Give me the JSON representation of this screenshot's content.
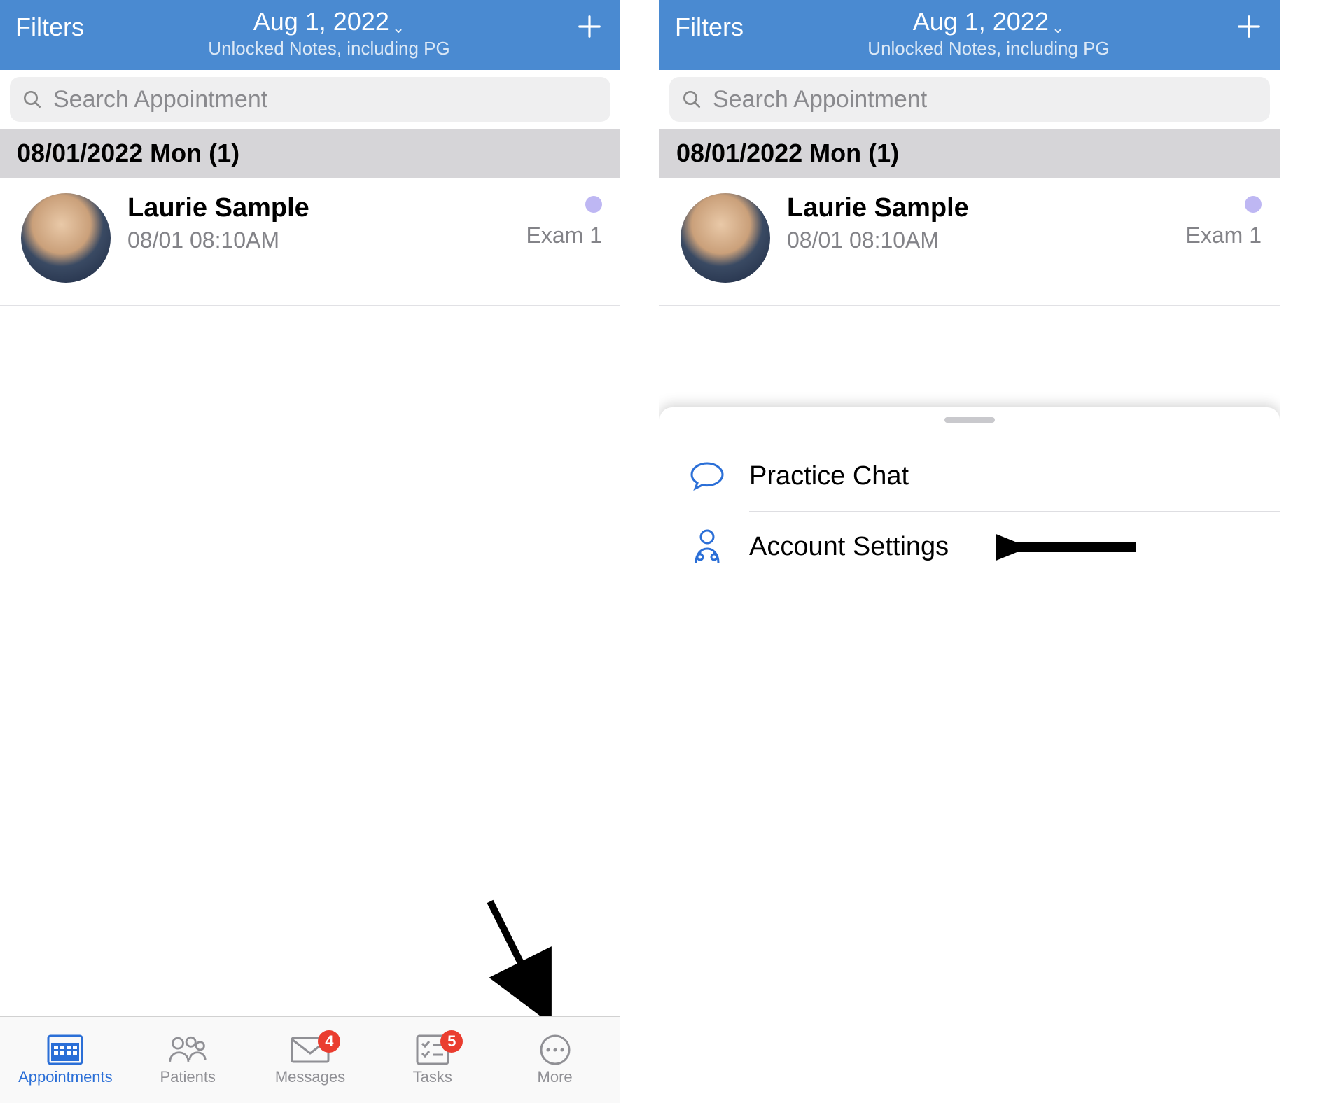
{
  "header": {
    "filters_label": "Filters",
    "date": "Aug 1, 2022",
    "subtitle": "Unlocked Notes, including PG"
  },
  "search": {
    "placeholder": "Search Appointment"
  },
  "section": {
    "title": "08/01/2022 Mon (1)"
  },
  "appointment": {
    "name": "Laurie Sample",
    "time": "08/01 08:10AM",
    "room": "Exam 1"
  },
  "tabs": {
    "appointments": "Appointments",
    "patients": "Patients",
    "messages": "Messages",
    "messages_badge": "4",
    "tasks": "Tasks",
    "tasks_badge": "5",
    "more": "More"
  },
  "sheet": {
    "practice_chat": "Practice Chat",
    "account_settings": "Account Settings"
  }
}
